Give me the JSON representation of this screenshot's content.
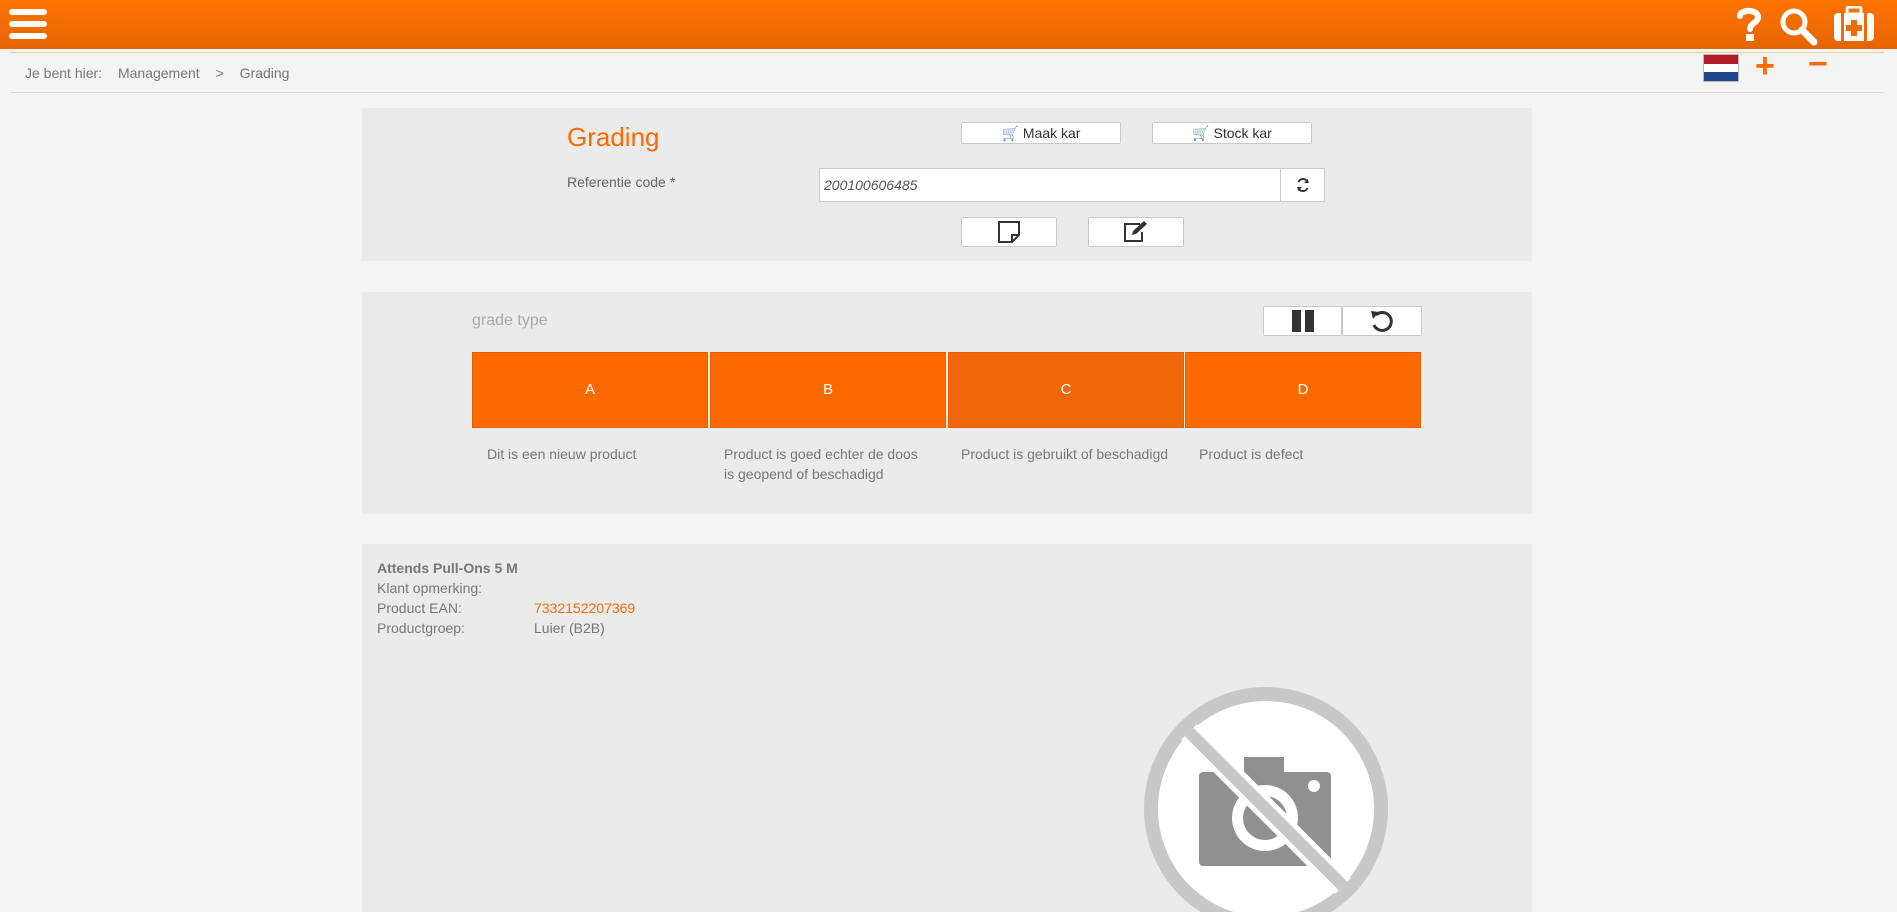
{
  "topbar": {
    "icons": [
      "menu-icon",
      "help-icon",
      "search-icon",
      "first-aid-kit-icon"
    ],
    "accent": "#ff6a00"
  },
  "breadcrumb": {
    "prefix": "Je bent hier:",
    "items": [
      "Management",
      "Grading"
    ],
    "separator": ">"
  },
  "language": {
    "flag": "netherlands-flag-icon"
  },
  "zoom": {
    "plus": "+",
    "minus": "−"
  },
  "form": {
    "title": "Grading",
    "make_cart_label": "Maak kar",
    "stock_cart_label": "Stock kar",
    "ref_label": "Referentie code *",
    "ref_value": "200100606485"
  },
  "grading": {
    "label": "grade type",
    "grades": [
      {
        "label": "A",
        "description": "Dit is een nieuw product"
      },
      {
        "label": "B",
        "description": "Product is goed echter de doos is geopend of beschadigd"
      },
      {
        "label": "C",
        "description": "Product is gebruikt of beschadigd"
      },
      {
        "label": "D",
        "description": "Product is defect"
      }
    ]
  },
  "product": {
    "name": "Attends Pull-Ons 5 M",
    "fields": [
      {
        "label": "Klant opmerking:",
        "value": ""
      },
      {
        "label": "Product EAN:",
        "value": "7332152207369"
      },
      {
        "label": "Productgroep:",
        "value": "Luier (B2B)"
      }
    ],
    "image": "no-photo-icon"
  }
}
